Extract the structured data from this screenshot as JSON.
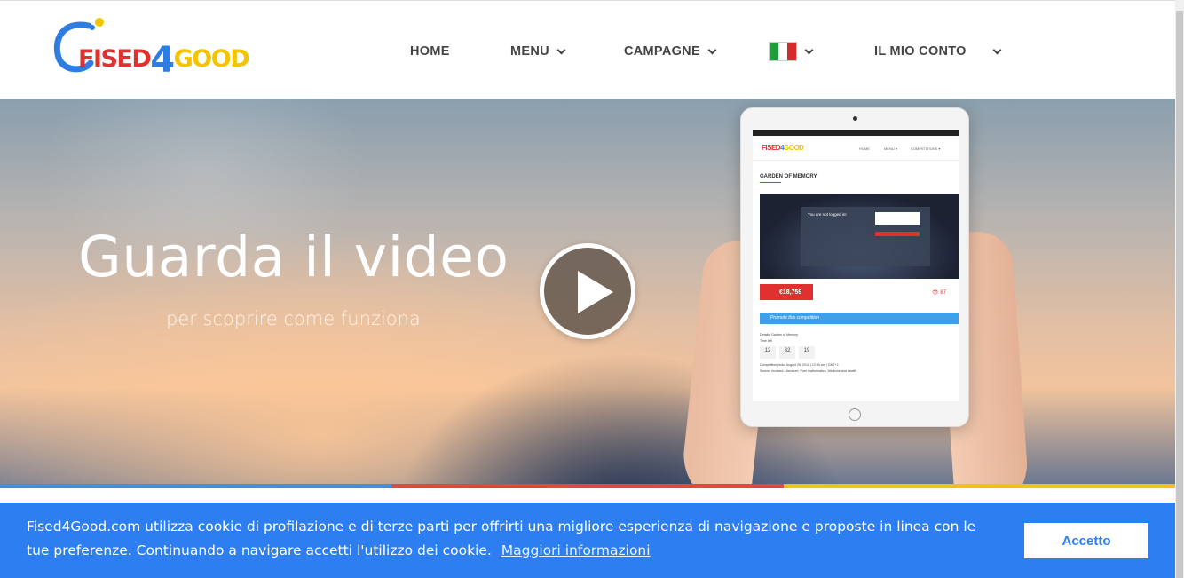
{
  "brand": {
    "logo_text_left": "FISED",
    "logo_text_four": "4",
    "logo_text_right": "GOOD",
    "colors": {
      "blue": "#2f7de1",
      "red": "#e03030",
      "yellow": "#f4c400"
    }
  },
  "nav": {
    "home": "HOME",
    "menu": "MENU",
    "campaigns": "CAMPAGNE",
    "language_flag": "italian-flag",
    "account": "IL MIO CONTO"
  },
  "hero": {
    "title": "Guarda il video",
    "subtitle": "per scoprire come funziona"
  },
  "stripe_colors": [
    "#3f92e3",
    "#e2483c",
    "#f1c11a"
  ],
  "cookie": {
    "text": "Fised4Good.com utilizza cookie di profilazione e di terze parti per offrirti una migliore esperienza di navigazione e proposte in linea con le tue preferenze. Continuando a navigare accetti l'utilizzo dei cookie.",
    "link": "Maggiori informazioni",
    "accept": "Accetto",
    "background": "#2d7ff1"
  }
}
